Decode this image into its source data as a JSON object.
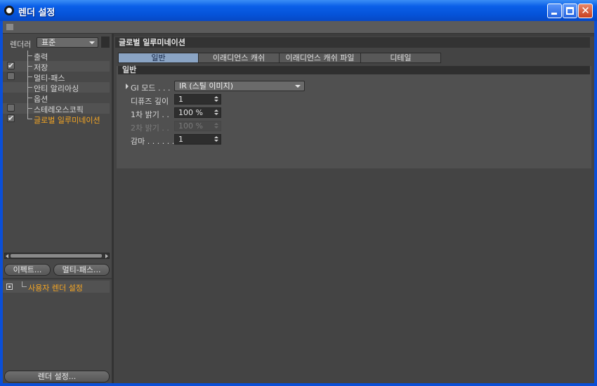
{
  "window": {
    "title": "렌더 설정",
    "icon": "cinema4d-logo-icon",
    "controls": [
      "minimize-icon",
      "maximize-icon",
      "close-icon"
    ],
    "close_glyph": "✕"
  },
  "left": {
    "renderer_label": "렌더러",
    "renderer_value": "표준",
    "tree": [
      {
        "label": "출력",
        "checkbox": "none",
        "active": false
      },
      {
        "label": "저장",
        "checkbox": "checked",
        "active": false
      },
      {
        "label": "멀티-패스",
        "checkbox": "unchecked",
        "active": false
      },
      {
        "label": "안티 알리아싱",
        "checkbox": "none",
        "active": false
      },
      {
        "label": "옵션",
        "checkbox": "none",
        "active": false
      },
      {
        "label": "스테레오스코픽",
        "checkbox": "unchecked",
        "active": false
      },
      {
        "label": "글로벌 일루미네이션",
        "checkbox": "checked",
        "active": true
      }
    ],
    "check_glyph": "✔",
    "effect_button": "이펙트...",
    "multipass_button": "멀티-패스...",
    "user_settings_label": "사용자 렌더 설정",
    "render_settings_button": "렌더 설정..."
  },
  "right": {
    "section_title": "글로벌 일루미네이션",
    "tabs": [
      {
        "label": "일반",
        "active": true
      },
      {
        "label": "이래디언스 캐쉬",
        "active": false
      },
      {
        "label": "이래디언스 캐쉬 파일",
        "active": false
      },
      {
        "label": "디테일",
        "active": false
      }
    ],
    "group_title": "일반",
    "params": {
      "gi_mode": {
        "label": "GI 모드 . . .",
        "value": "IR (스틸 이미지)"
      },
      "diffuse_depth": {
        "label": "디퓨즈 깊이",
        "value": "1"
      },
      "primary_intensity": {
        "label": "1차 밝기 . .",
        "value": "100 %"
      },
      "secondary_intensity": {
        "label": "2차 밝기 . .",
        "value": "100 %",
        "disabled": true
      },
      "gamma": {
        "label": "감마 . . . . . .",
        "value": "1"
      }
    }
  },
  "colors": {
    "accent_orange": "#f5a623",
    "active_tab": "#8aa4c4",
    "titlebar_blue": "#0553d8"
  }
}
